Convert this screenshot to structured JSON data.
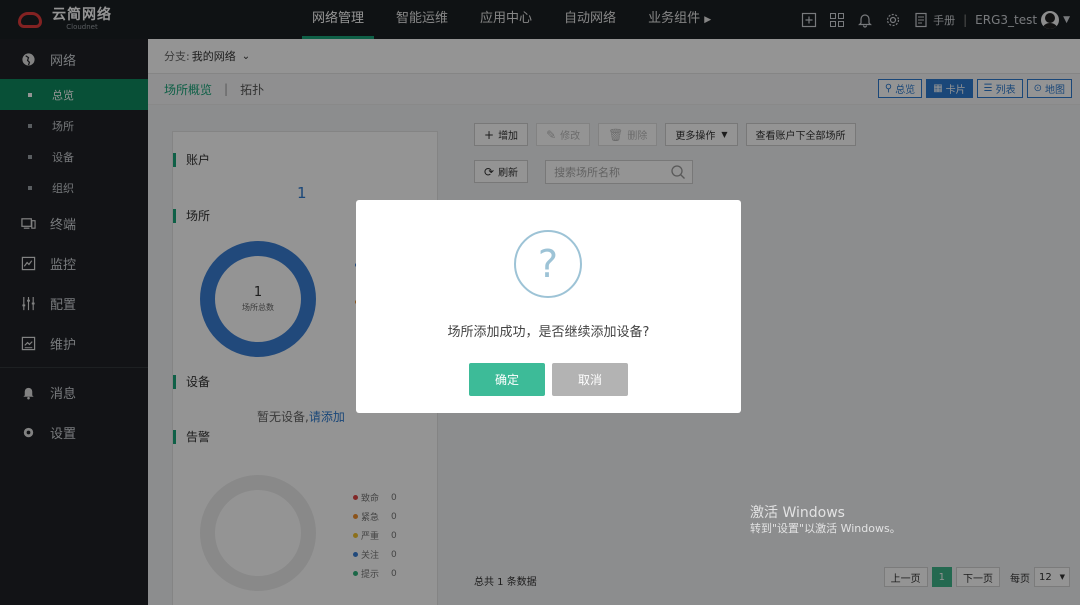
{
  "app": {
    "logo_title": "云简网络",
    "logo_sub": "Cloudnet"
  },
  "topnav": [
    {
      "label": "网络管理"
    },
    {
      "label": "智能运维"
    },
    {
      "label": "应用中心"
    },
    {
      "label": "自动网络"
    },
    {
      "label": "业务组件"
    }
  ],
  "topright": {
    "manual": "手册",
    "user": "ERG3_test"
  },
  "sidebar": {
    "network": "网络",
    "sub": [
      "总览",
      "场所",
      "设备",
      "组织"
    ],
    "terminal": "终端",
    "monitor": "监控",
    "config": "配置",
    "maintain": "维护",
    "messages": "消息",
    "settings": "设置"
  },
  "branch": {
    "label": "分支:",
    "value": "我的网络"
  },
  "tabs": {
    "overview": "场所概览",
    "separator": "|",
    "topology": "拓扑"
  },
  "views": {
    "overview": "总览",
    "card": "卡片",
    "list": "列表",
    "map": "地图"
  },
  "panel": {
    "account_title": "账户",
    "account_count": "1",
    "site_title": "场所",
    "site_total": "1",
    "site_total_label": "场所总数",
    "device_title": "设备",
    "no_device": "暂无设备,",
    "add_link": "请添加",
    "alarm_title": "告警",
    "alarms": [
      {
        "name": "致命",
        "count": "0",
        "color": "#e04545"
      },
      {
        "name": "紧急",
        "count": "0",
        "color": "#f0902e"
      },
      {
        "name": "严重",
        "count": "0",
        "color": "#f2c230"
      },
      {
        "name": "关注",
        "count": "0",
        "color": "#3a7fd5"
      },
      {
        "name": "提示",
        "count": "0",
        "color": "#2fb27a"
      }
    ]
  },
  "toolbar": {
    "add": "增加",
    "edit": "修改",
    "delete": "删除",
    "more": "更多操作",
    "view_all": "查看账户下全部场所",
    "refresh": "刷新",
    "search_placeholder": "搜索场所名称"
  },
  "footer": {
    "total": "总共 1 条数据",
    "prev": "上一页",
    "page": "1",
    "next": "下一页",
    "per_page": "每页",
    "page_size": "12"
  },
  "watermark": {
    "line1": "激活 Windows",
    "line2": "转到\"设置\"以激活 Windows。"
  },
  "dialog": {
    "icon": "?",
    "message": "场所添加成功，是否继续添加设备?",
    "ok": "确定",
    "cancel": "取消"
  },
  "colors": {
    "accent": "#1aa57a",
    "primary": "#2e7bd0",
    "ok_button": "#3dbb98",
    "cancel_button": "#b3b3b3"
  }
}
